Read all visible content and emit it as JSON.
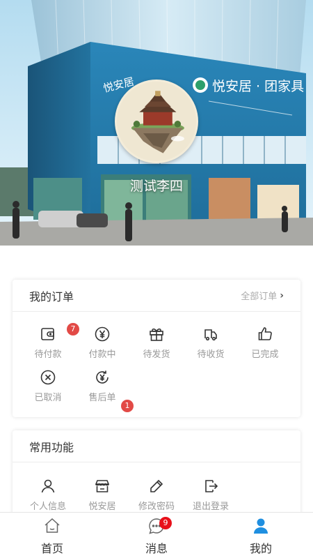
{
  "profile": {
    "username": "测试李四",
    "building_sign_left": "悦安居",
    "building_sign_right": "悦安居 · 团家具"
  },
  "orders": {
    "title": "我的订单",
    "all_label": "全部订单",
    "items": [
      {
        "label": "待付款",
        "icon": "wallet-icon",
        "badge": "7"
      },
      {
        "label": "付款中",
        "icon": "yuan-circle-icon",
        "badge": ""
      },
      {
        "label": "待发货",
        "icon": "gift-box-icon",
        "badge": ""
      },
      {
        "label": "待收货",
        "icon": "delivery-truck-icon",
        "badge": ""
      },
      {
        "label": "已完成",
        "icon": "thumbs-up-icon",
        "badge": ""
      },
      {
        "label": "已取消",
        "icon": "cancel-circle-icon",
        "badge": ""
      },
      {
        "label": "售后单",
        "icon": "refund-yuan-icon",
        "badge": "1"
      }
    ]
  },
  "functions": {
    "title": "常用功能",
    "items": [
      {
        "label": "个人信息",
        "icon": "user-icon"
      },
      {
        "label": "悦安居",
        "icon": "store-icon"
      },
      {
        "label": "修改密码",
        "icon": "pencil-icon"
      },
      {
        "label": "退出登录",
        "icon": "logout-icon"
      }
    ]
  },
  "tabbar": {
    "items": [
      {
        "label": "首页",
        "icon": "home-icon",
        "active": false
      },
      {
        "label": "消息",
        "icon": "message-icon",
        "active": false,
        "badge": "9"
      },
      {
        "label": "我的",
        "icon": "profile-icon",
        "active": true
      }
    ],
    "active_color": "#1f8fe0"
  },
  "colors": {
    "badge_red": "#e24a46",
    "tab_badge_red": "#e8101a",
    "sky_blue": "#bfe3f3",
    "building_blue": "#1f6690"
  }
}
